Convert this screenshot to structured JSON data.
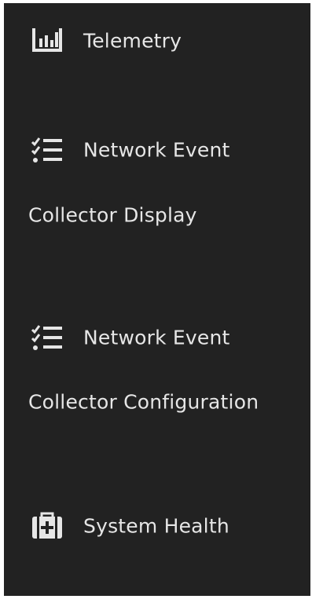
{
  "sidebar": {
    "background": "#222222",
    "text_color": "#e6e6e6",
    "items": [
      {
        "label": "Telemetry",
        "icon": "bar-chart-icon"
      },
      {
        "label": "Network Event",
        "label_line2": "Collector Display",
        "icon": "checklist-icon"
      },
      {
        "label": "Network Event",
        "label_line2": "Collector Configuration",
        "icon": "checklist-icon"
      },
      {
        "label": "System Health",
        "icon": "medical-kit-icon"
      }
    ]
  }
}
